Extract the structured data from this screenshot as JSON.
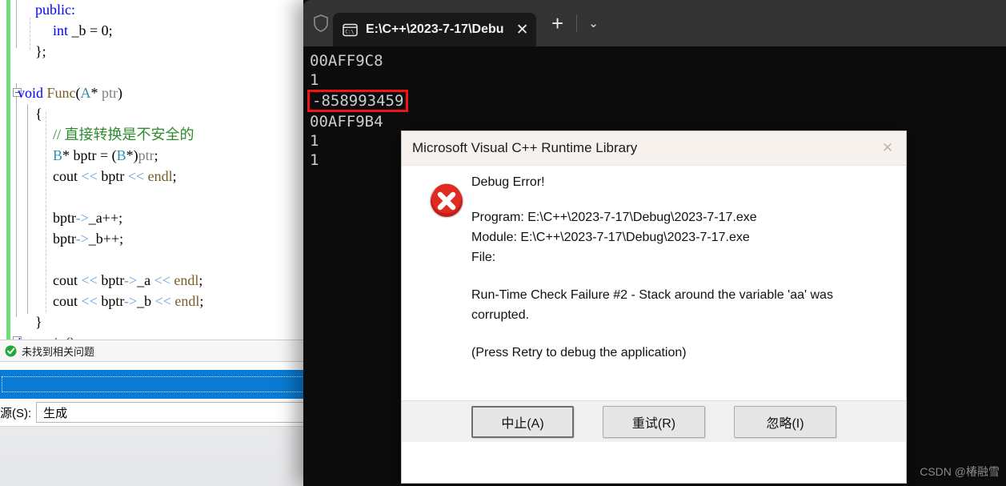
{
  "editor": {
    "name": "visual-studio-code-editor",
    "lines": [
      {
        "indent": 1,
        "tokens": [
          {
            "t": "public:",
            "c": "kw"
          }
        ]
      },
      {
        "indent": 2,
        "tokens": [
          {
            "t": "int",
            "c": "kw"
          },
          {
            "t": " _b = ",
            "c": "pln"
          },
          {
            "t": "0",
            "c": "pln"
          },
          {
            "t": ";",
            "c": "pln"
          }
        ]
      },
      {
        "indent": 1,
        "tokens": [
          {
            "t": "};",
            "c": "pln"
          }
        ]
      },
      {
        "indent": 0,
        "tokens": []
      },
      {
        "indent": 0,
        "tokens": [
          {
            "t": "void",
            "c": "kw"
          },
          {
            "t": " Func",
            "c": "fn"
          },
          {
            "t": "(",
            "c": "pln"
          },
          {
            "t": "A",
            "c": "typ"
          },
          {
            "t": "* ",
            "c": "pln"
          },
          {
            "t": "ptr",
            "c": "prm"
          },
          {
            "t": ")",
            "c": "pln"
          }
        ]
      },
      {
        "indent": 1,
        "tokens": [
          {
            "t": "{",
            "c": "pln"
          }
        ]
      },
      {
        "indent": 2,
        "tokens": [
          {
            "t": "// 直接转换是不安全的",
            "c": "cmt"
          }
        ]
      },
      {
        "indent": 2,
        "tokens": [
          {
            "t": "B",
            "c": "typ"
          },
          {
            "t": "* bptr = (",
            "c": "pln"
          },
          {
            "t": "B",
            "c": "typ"
          },
          {
            "t": "*)",
            "c": "pln"
          },
          {
            "t": "ptr",
            "c": "prm"
          },
          {
            "t": ";",
            "c": "pln"
          }
        ]
      },
      {
        "indent": 2,
        "tokens": [
          {
            "t": "cout ",
            "c": "pln"
          },
          {
            "t": "<<",
            "c": "op"
          },
          {
            "t": " bptr ",
            "c": "pln"
          },
          {
            "t": "<<",
            "c": "op"
          },
          {
            "t": " endl",
            "c": "fn"
          },
          {
            "t": ";",
            "c": "pln"
          }
        ]
      },
      {
        "indent": 0,
        "tokens": []
      },
      {
        "indent": 2,
        "tokens": [
          {
            "t": "bptr",
            "c": "pln"
          },
          {
            "t": "->",
            "c": "op"
          },
          {
            "t": "_a++;",
            "c": "pln"
          }
        ]
      },
      {
        "indent": 2,
        "tokens": [
          {
            "t": "bptr",
            "c": "pln"
          },
          {
            "t": "->",
            "c": "op"
          },
          {
            "t": "_b++;",
            "c": "pln"
          }
        ]
      },
      {
        "indent": 0,
        "tokens": []
      },
      {
        "indent": 2,
        "tokens": [
          {
            "t": "cout ",
            "c": "pln"
          },
          {
            "t": "<<",
            "c": "op"
          },
          {
            "t": " bptr",
            "c": "pln"
          },
          {
            "t": "->",
            "c": "op"
          },
          {
            "t": "_a ",
            "c": "pln"
          },
          {
            "t": "<<",
            "c": "op"
          },
          {
            "t": " endl",
            "c": "fn"
          },
          {
            "t": ";",
            "c": "pln"
          }
        ]
      },
      {
        "indent": 2,
        "tokens": [
          {
            "t": "cout ",
            "c": "pln"
          },
          {
            "t": "<<",
            "c": "op"
          },
          {
            "t": " bptr",
            "c": "pln"
          },
          {
            "t": "->",
            "c": "op"
          },
          {
            "t": "_b ",
            "c": "pln"
          },
          {
            "t": "<<",
            "c": "op"
          },
          {
            "t": " endl",
            "c": "fn"
          },
          {
            "t": ";",
            "c": "pln"
          }
        ]
      },
      {
        "indent": 1,
        "tokens": [
          {
            "t": "}",
            "c": "pln"
          }
        ]
      },
      {
        "indent": 0,
        "tokens": [
          {
            "t": "int",
            "c": "kw"
          },
          {
            "t": " ",
            "c": "pln"
          },
          {
            "t": "main",
            "c": "fn"
          },
          {
            "t": "()",
            "c": "pln"
          }
        ]
      }
    ],
    "error_list": {
      "status_text": "未找到相关问题",
      "icon": "check-circle-icon"
    },
    "source_row": {
      "label": "源(S):",
      "value": "生成"
    }
  },
  "terminal": {
    "shield_icon": "shield-icon",
    "tab": {
      "icon": "console-icon",
      "title": "E:\\C++\\2023-7-17\\Debu",
      "close_label": "✕"
    },
    "new_tab_label": "+",
    "dropdown_label": "⌄",
    "output": [
      {
        "text": "00AFF9C8",
        "boxed": false
      },
      {
        "text": "1",
        "boxed": false
      },
      {
        "text": "-858993459",
        "boxed": true
      },
      {
        "text": "00AFF9B4",
        "boxed": false
      },
      {
        "text": "1",
        "boxed": false
      },
      {
        "text": "1",
        "boxed": false
      }
    ],
    "highlight_color": "#f01414"
  },
  "dialog": {
    "title": "Microsoft Visual C++ Runtime Library",
    "close_label": "✕",
    "icon": "error-icon",
    "heading": "Debug Error!",
    "program_line": "Program: E:\\C++\\2023-7-17\\Debug\\2023-7-17.exe",
    "module_line": "Module: E:\\C++\\2023-7-17\\Debug\\2023-7-17.exe",
    "file_line": "File:",
    "failure_message": "Run-Time Check Failure #2 - Stack around the variable 'aa' was corrupted.",
    "hint_message": "(Press Retry to debug the application)",
    "buttons": [
      {
        "label": "中止(A)",
        "name": "abort-button",
        "default": true
      },
      {
        "label": "重试(R)",
        "name": "retry-button",
        "default": false
      },
      {
        "label": "忽略(I)",
        "name": "ignore-button",
        "default": false
      }
    ]
  },
  "watermark": {
    "text": "CSDN @椿融雪"
  }
}
